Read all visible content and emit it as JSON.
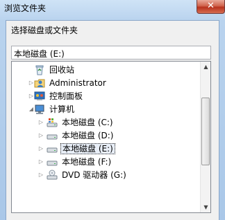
{
  "window": {
    "title": "浏览文件夹",
    "close_glyph": "✕"
  },
  "dialog": {
    "prompt": "选择磁盘或文件夹",
    "folder_value": "本地磁盘 (E:)"
  },
  "tree": {
    "items": [
      {
        "label": "回收站",
        "icon": "recycle-bin-icon",
        "expander": ""
      },
      {
        "label": "Administrator",
        "icon": "user-folder-icon",
        "expander": "▷"
      },
      {
        "label": "控制面板",
        "icon": "control-panel-icon",
        "expander": "▷"
      },
      {
        "label": "计算机",
        "icon": "computer-icon",
        "expander": "◢"
      },
      {
        "label": "本地磁盘 (C:)",
        "icon": "windows-drive-icon",
        "expander": "▷"
      },
      {
        "label": "本地磁盘 (D:)",
        "icon": "drive-icon",
        "expander": "▷"
      },
      {
        "label": "本地磁盘 (E:)",
        "icon": "drive-icon",
        "expander": "▷",
        "selected": true
      },
      {
        "label": "本地磁盘 (F:)",
        "icon": "drive-icon",
        "expander": "▷"
      },
      {
        "label": "DVD 驱动器 (G:)",
        "icon": "dvd-drive-icon",
        "expander": "▷"
      }
    ]
  },
  "scrollbar": {
    "up_glyph": "▲",
    "down_glyph": "▼"
  }
}
